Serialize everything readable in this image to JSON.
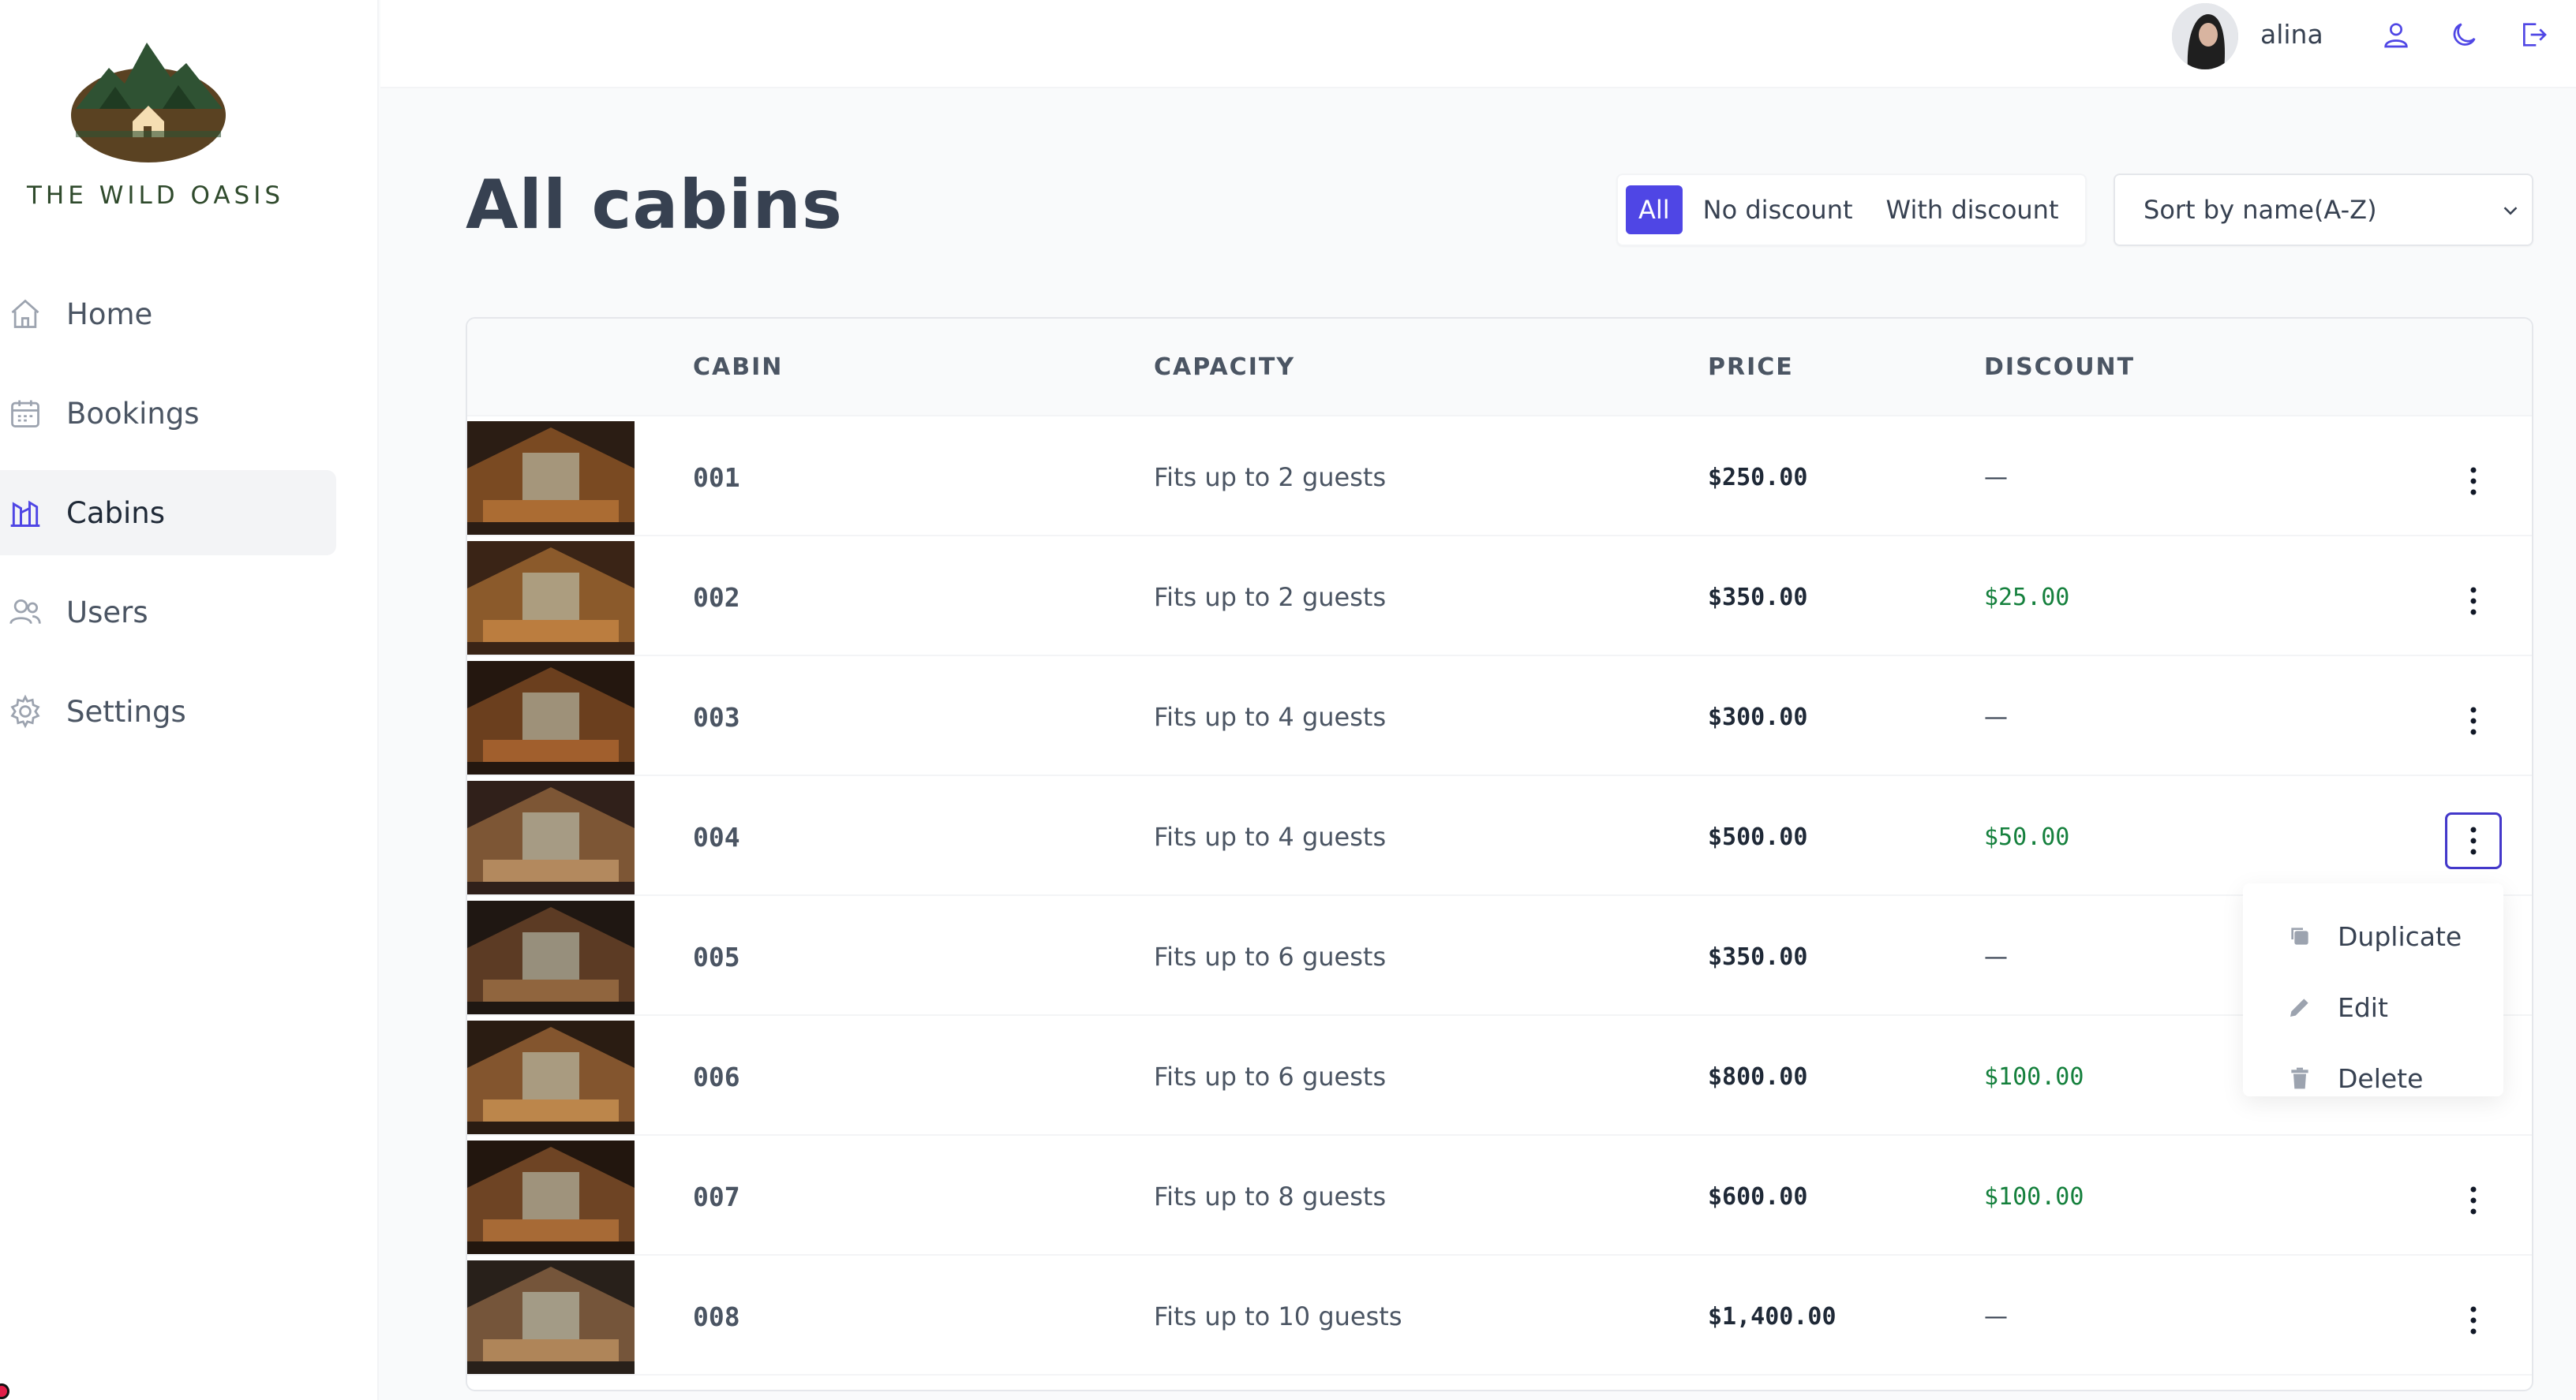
{
  "app": {
    "brand": "THE WILD OASIS"
  },
  "sidebar": {
    "items": [
      {
        "label": "Home",
        "icon": "home-icon",
        "active": false
      },
      {
        "label": "Bookings",
        "icon": "calendar-icon",
        "active": false
      },
      {
        "label": "Cabins",
        "icon": "cabins-icon",
        "active": true
      },
      {
        "label": "Users",
        "icon": "users-icon",
        "active": false
      },
      {
        "label": "Settings",
        "icon": "gear-icon",
        "active": false
      }
    ]
  },
  "header": {
    "username": "alina"
  },
  "page": {
    "title": "All cabins"
  },
  "filter": {
    "options": [
      "All",
      "No discount",
      "With discount"
    ],
    "selected": "All"
  },
  "sort": {
    "value": "Sort by name(A-Z)"
  },
  "table": {
    "headers": [
      "CABIN",
      "CAPACITY",
      "PRICE",
      "DISCOUNT"
    ],
    "rows": [
      {
        "name": "001",
        "capacity": "Fits up to 2 guests",
        "price": "$250.00",
        "discount": "—",
        "has_discount": false
      },
      {
        "name": "002",
        "capacity": "Fits up to 2 guests",
        "price": "$350.00",
        "discount": "$25.00",
        "has_discount": true
      },
      {
        "name": "003",
        "capacity": "Fits up to 4 guests",
        "price": "$300.00",
        "discount": "—",
        "has_discount": false
      },
      {
        "name": "004",
        "capacity": "Fits up to 4 guests",
        "price": "$500.00",
        "discount": "$50.00",
        "has_discount": true
      },
      {
        "name": "005",
        "capacity": "Fits up to 6 guests",
        "price": "$350.00",
        "discount": "—",
        "has_discount": false
      },
      {
        "name": "006",
        "capacity": "Fits up to 6 guests",
        "price": "$800.00",
        "discount": "$100.00",
        "has_discount": true
      },
      {
        "name": "007",
        "capacity": "Fits up to 8 guests",
        "price": "$600.00",
        "discount": "$100.00",
        "has_discount": true
      },
      {
        "name": "008",
        "capacity": "Fits up to 10 guests",
        "price": "$1,400.00",
        "discount": "—",
        "has_discount": false
      }
    ]
  },
  "context_menu": {
    "items": [
      {
        "label": "Duplicate",
        "icon": "duplicate-icon"
      },
      {
        "label": "Edit",
        "icon": "pencil-icon"
      },
      {
        "label": "Delete",
        "icon": "trash-icon"
      }
    ]
  },
  "colors": {
    "accent": "#4f46e5",
    "discount": "#15803d",
    "text": "#374151"
  }
}
